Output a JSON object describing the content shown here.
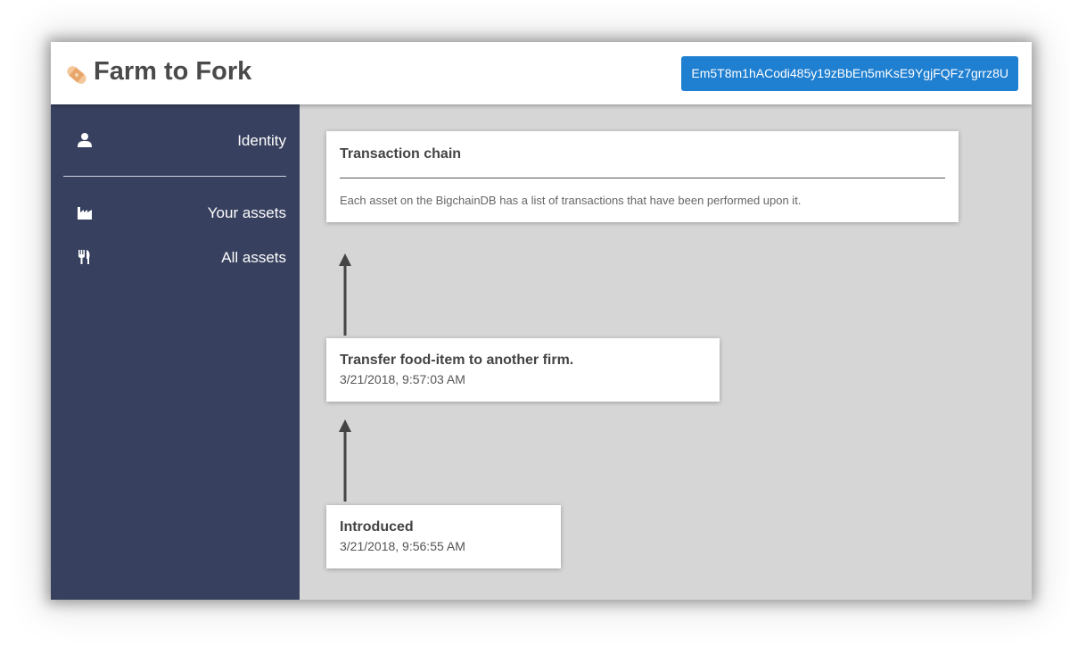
{
  "app": {
    "title": "Farm to Fork",
    "public_key": "Em5T8m1hACodi485y19zBbEn5mKsE9YgjFQFz7grrz8U"
  },
  "sidebar": {
    "items": [
      {
        "label": "Identity",
        "icon": "user-icon"
      },
      {
        "label": "Your assets",
        "icon": "factory-icon"
      },
      {
        "label": "All assets",
        "icon": "utensils-icon"
      }
    ]
  },
  "main": {
    "info": {
      "title": "Transaction chain",
      "description": "Each asset on the BigchainDB has a list of transactions that have been performed upon it."
    },
    "transactions": [
      {
        "title": "Transfer food-item to another firm.",
        "time": "3/21/2018, 9:57:03 AM"
      },
      {
        "title": "Introduced",
        "time": "3/21/2018, 9:56:55 AM"
      }
    ]
  },
  "colors": {
    "sidebar": "#37405e",
    "accent": "#1f7fd0",
    "main_background": "#d6d6d6"
  }
}
